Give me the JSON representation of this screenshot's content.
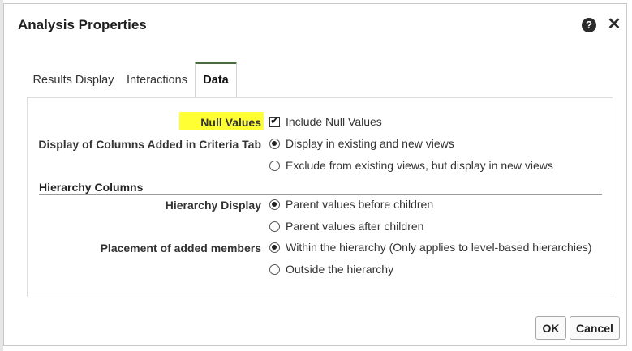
{
  "dialog": {
    "title": "Analysis Properties",
    "help_icon": "?",
    "close_icon": "✕"
  },
  "tabs": [
    {
      "label": "Results Display",
      "active": false
    },
    {
      "label": "Interactions",
      "active": false
    },
    {
      "label": "Data",
      "active": true
    }
  ],
  "data_tab": {
    "null_values": {
      "label": "Null Values",
      "checkbox_label": "Include Null Values",
      "checked": true
    },
    "display_columns": {
      "label": "Display of Columns Added in Criteria Tab",
      "options": [
        {
          "label": "Display in existing and new views",
          "selected": true
        },
        {
          "label": "Exclude from existing views, but display in new views",
          "selected": false
        }
      ]
    },
    "hierarchy_section_title": "Hierarchy Columns",
    "hierarchy_display": {
      "label": "Hierarchy Display",
      "options": [
        {
          "label": "Parent values before children",
          "selected": true
        },
        {
          "label": "Parent values after children",
          "selected": false
        }
      ]
    },
    "placement_members": {
      "label": "Placement of added members",
      "options": [
        {
          "label": "Within the hierarchy (Only applies to level-based hierarchies)",
          "selected": true
        },
        {
          "label": "Outside the hierarchy",
          "selected": false
        }
      ]
    }
  },
  "buttons": {
    "ok": "OK",
    "cancel": "Cancel"
  },
  "colors": {
    "highlight": "#ffff33",
    "active_tab_border": "#4a6b3e"
  }
}
